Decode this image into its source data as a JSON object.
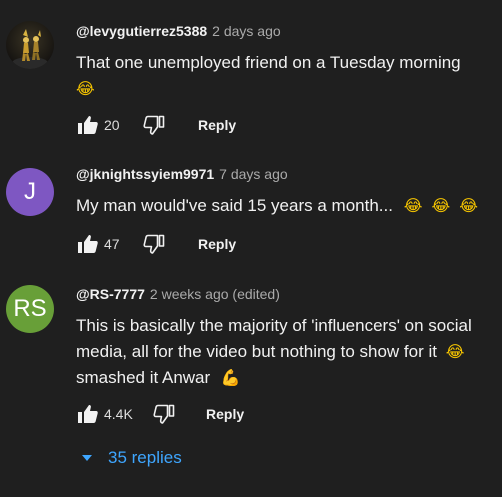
{
  "comments": [
    {
      "author": "@levygutierrez5388",
      "time": "2 days ago",
      "avatar_type": "photo",
      "text_lines": [
        "That one unemployed friend on a Tuesday morning",
        "😂"
      ],
      "likes": "20",
      "reply_label": "Reply"
    },
    {
      "author": "@jknightssyiem9971",
      "time": "7 days ago",
      "avatar_letter": "J",
      "avatar_color": "#7e57c2",
      "text": "My man would've said 15 years a month...",
      "text_emoji": "😂 😂 😂",
      "likes": "47",
      "reply_label": "Reply"
    },
    {
      "author": "@RS-7777",
      "time": "2 weeks ago (edited)",
      "avatar_letter": "RS",
      "avatar_color": "#689f38",
      "text_lines": [
        "This is basically the majority of 'influencers' on social",
        "media, all for the video but nothing to show for it",
        "smashed it Anwar"
      ],
      "line2_emoji": "😂",
      "line3_emoji": "💪",
      "likes": "4.4K",
      "reply_label": "Reply",
      "replies_toggle": "35 replies"
    }
  ],
  "colors": {
    "background": "#1f1f1f",
    "link_blue": "#3ea6ff",
    "secondary_text": "#aaaaaa"
  },
  "icons": [
    "thumbs-up-icon",
    "thumbs-down-icon",
    "caret-down-icon",
    "laughing-emoji",
    "flexed-bicep-emoji"
  ]
}
